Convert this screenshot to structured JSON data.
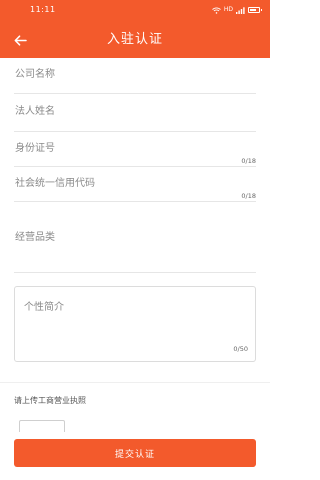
{
  "status_bar": {
    "time": "11:11",
    "network": "HD",
    "battery_level": 0.8
  },
  "header": {
    "title": "入驻认证",
    "back_icon": "arrow-left-icon"
  },
  "form": {
    "company_name": {
      "placeholder": "公司名称",
      "value": ""
    },
    "legal_person": {
      "placeholder": "法人姓名",
      "value": ""
    },
    "id_number": {
      "placeholder": "身份证号",
      "value": "",
      "counter": "0/18"
    },
    "credit_code": {
      "placeholder": "社会统一信用代码",
      "value": "",
      "counter": "0/18"
    },
    "category": {
      "placeholder": "经营品类",
      "value": ""
    },
    "intro": {
      "placeholder": "个性简介",
      "value": "",
      "counter": "0/50"
    },
    "license_label": "请上传工商营业执照"
  },
  "actions": {
    "submit_label": "提交认证"
  },
  "colors": {
    "brand": "#f35a2c",
    "divider": "#e6e6e6",
    "placeholder": "#8a8a8a"
  }
}
